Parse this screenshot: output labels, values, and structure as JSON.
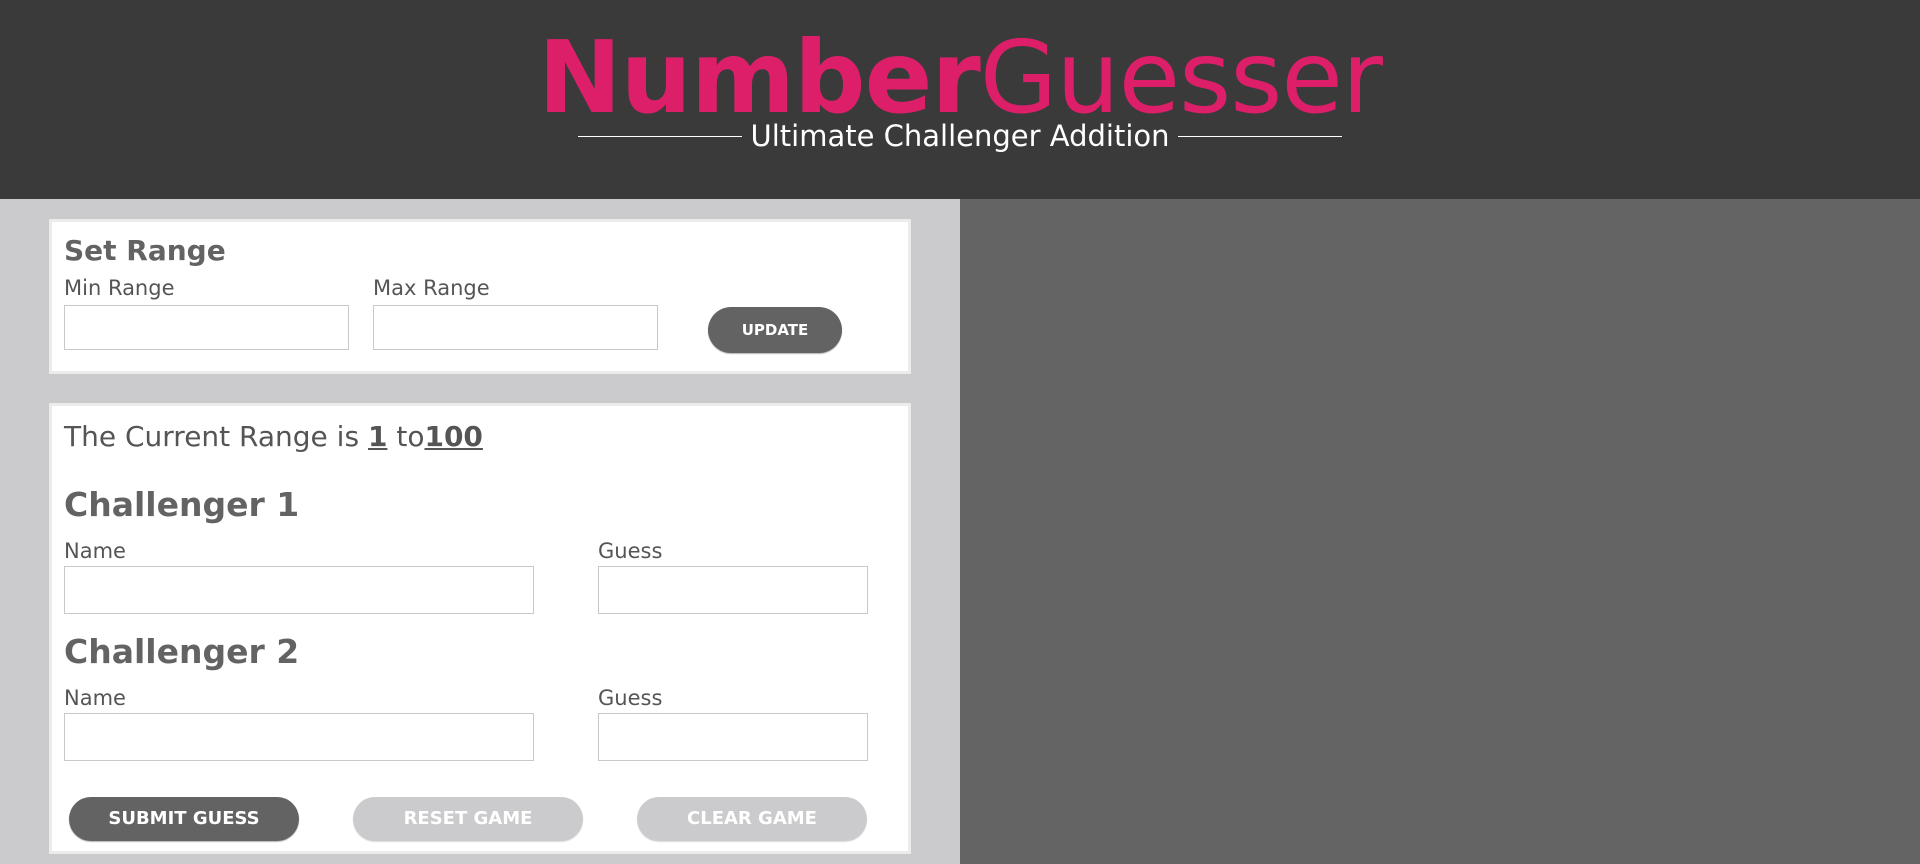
{
  "header": {
    "logo_bold": "Number",
    "logo_light": "Guesser",
    "subtitle": "Ultimate Challenger Addition",
    "logo_color": "#dd1f6a",
    "background_color": "#3a3a3a"
  },
  "set_range": {
    "title": "Set Range",
    "min_label": "Min Range",
    "min_value": "",
    "max_label": "Max Range",
    "max_value": "",
    "update_button": "UPDATE"
  },
  "game": {
    "range_prefix": "The Current Range is",
    "range_min": "1",
    "range_to": "to",
    "range_max": "100",
    "challengers": [
      {
        "title": "Challenger 1",
        "name_label": "Name",
        "name_value": "",
        "guess_label": "Guess",
        "guess_value": ""
      },
      {
        "title": "Challenger 2",
        "name_label": "Name",
        "name_value": "",
        "guess_label": "Guess",
        "guess_value": ""
      }
    ],
    "submit_button": "SUBMIT GUESS",
    "reset_button": "RESET GAME",
    "clear_button": "CLEAR GAME"
  },
  "colors": {
    "accent": "#dd1f6a",
    "left_panel": "#cbcbcd",
    "right_panel": "#646464",
    "button_dark": "#636363",
    "button_disabled": "#cbcbcd"
  }
}
